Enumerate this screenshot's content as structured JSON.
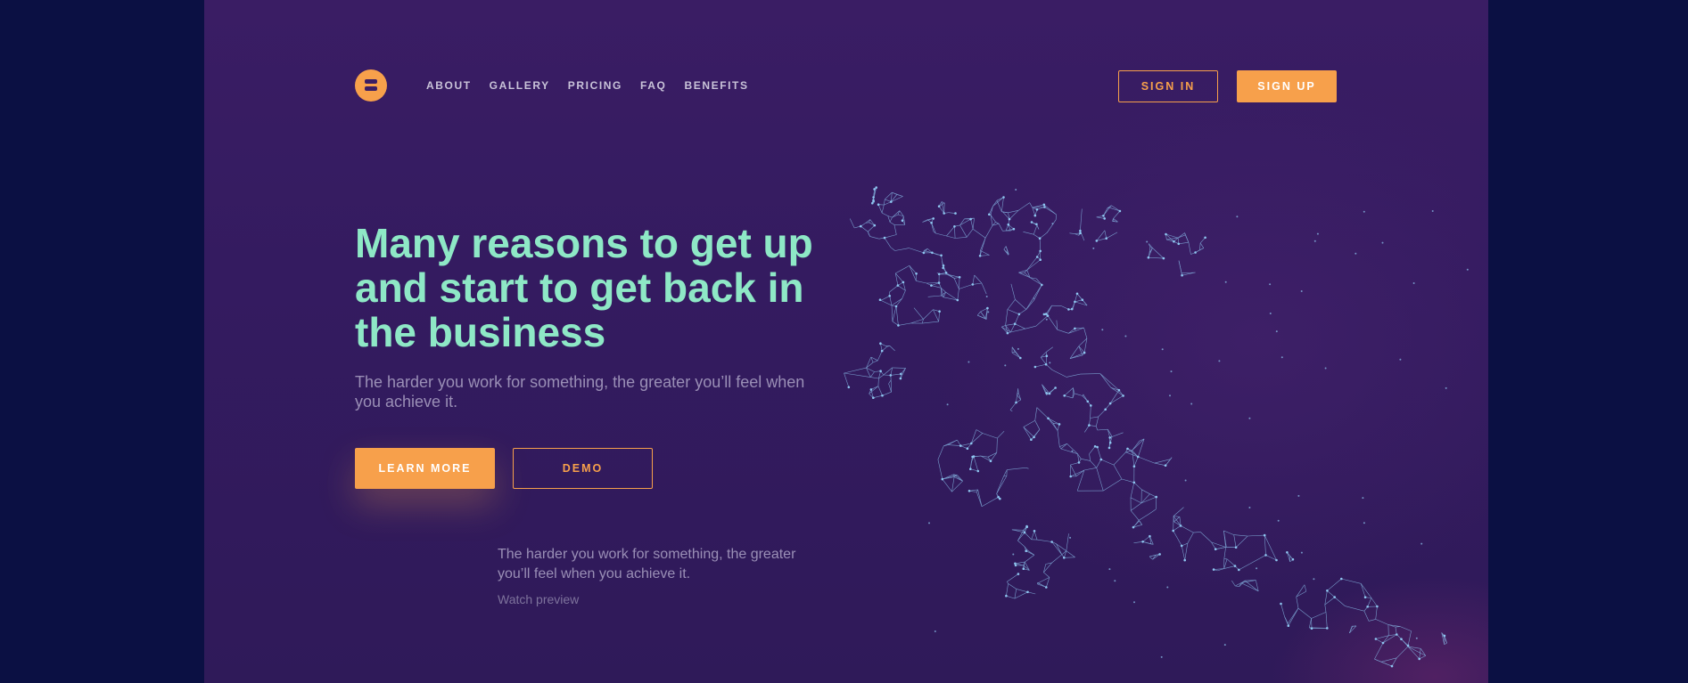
{
  "header": {
    "logo": "logo-icon",
    "nav": [
      "ABOUT",
      "GALLERY",
      "PRICING",
      "FAQ",
      "BENEFITS"
    ],
    "sign_in": "SIGN IN",
    "sign_up": "SIGN UP"
  },
  "hero": {
    "title": "Many reasons to get up and start to get back in the business",
    "subtitle": "The harder you work for something, the greater you’ll feel when you achieve it.",
    "learn_more": "LEARN MORE",
    "demo": "DEMO"
  },
  "quote": {
    "text": "The harder you work for something, the greater you’ll feel when you achieve it.",
    "link": "Watch preview"
  },
  "illustration": "running-man-mesh-illustration",
  "colors": {
    "accent": "#f7a04b",
    "title": "#8ee8c6",
    "background": "#3a1d64",
    "outer": "#0b1043",
    "mesh": "#8ec6f0"
  }
}
